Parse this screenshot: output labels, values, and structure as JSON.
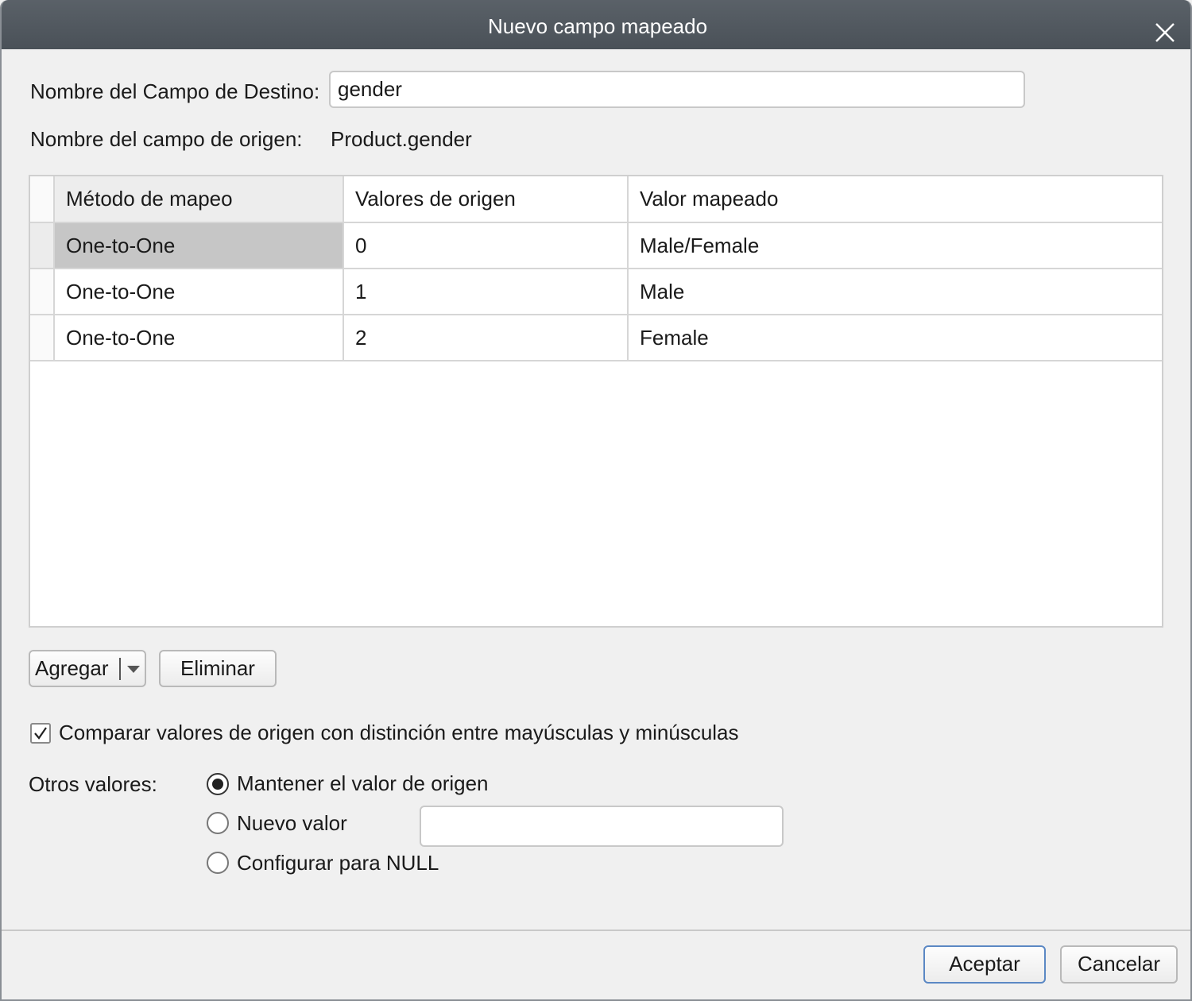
{
  "window": {
    "title": "Nuevo campo mapeado",
    "close_icon": "close-icon"
  },
  "fields": {
    "dest_label": "Nombre del Campo de Destino:",
    "dest_value": "gender",
    "src_label": "Nombre del campo de origen:",
    "src_value": "Product.gender"
  },
  "grid": {
    "headers": [
      "Método de mapeo",
      "Valores de origen",
      "Valor mapeado"
    ],
    "rows": [
      {
        "method": "One-to-One",
        "source": "0",
        "mapped": "Male/Female",
        "selected": true
      },
      {
        "method": "One-to-One",
        "source": "1",
        "mapped": "Male",
        "selected": false
      },
      {
        "method": "One-to-One",
        "source": "2",
        "mapped": "Female",
        "selected": false
      }
    ]
  },
  "buttons": {
    "add": "Agregar",
    "delete": "Eliminar",
    "ok": "Aceptar",
    "cancel": "Cancelar"
  },
  "case_sensitive": {
    "label": "Comparar valores de origen con distinción entre mayúsculas y minúsculas",
    "checked": true
  },
  "other_values": {
    "label": "Otros valores:",
    "options": [
      {
        "label": "Mantener el valor de origen",
        "selected": true
      },
      {
        "label": "Nuevo valor",
        "selected": false
      },
      {
        "label": "Configurar para NULL",
        "selected": false
      }
    ],
    "new_value": ""
  }
}
